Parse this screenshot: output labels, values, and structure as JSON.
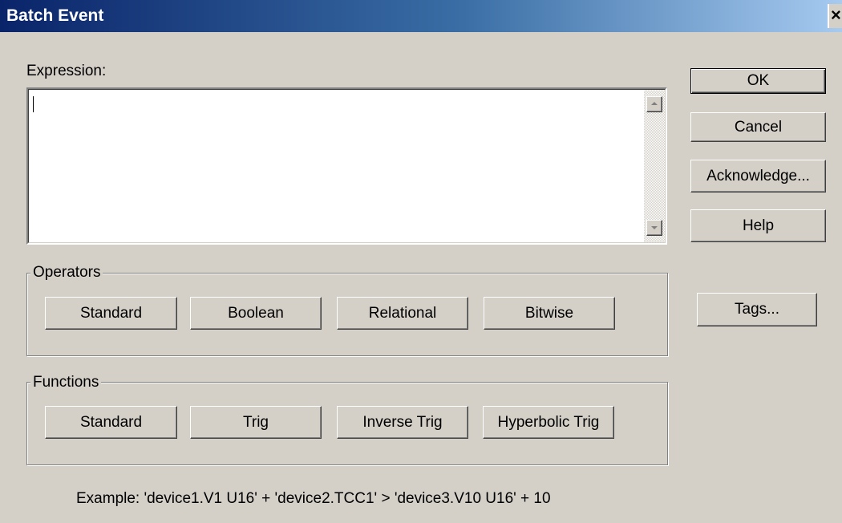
{
  "window": {
    "title": "Batch Event",
    "close_glyph": "×"
  },
  "expression": {
    "label": "Expression:",
    "value": ""
  },
  "side_buttons": {
    "ok": "OK",
    "cancel": "Cancel",
    "acknowledge": "Acknowledge...",
    "help": "Help",
    "tags": "Tags..."
  },
  "operators": {
    "title": "Operators",
    "buttons": [
      "Standard",
      "Boolean",
      "Relational",
      "Bitwise"
    ]
  },
  "functions": {
    "title": "Functions",
    "buttons": [
      "Standard",
      "Trig",
      "Inverse Trig",
      "Hyperbolic Trig"
    ]
  },
  "example_text": "Example:  'device1.V1 U16' + 'device2.TCC1' > 'device3.V10 U16' + 10",
  "icons": {
    "close": "close-icon",
    "scroll_up": "scroll-up-arrow-icon",
    "scroll_down": "scroll-down-arrow-icon"
  }
}
